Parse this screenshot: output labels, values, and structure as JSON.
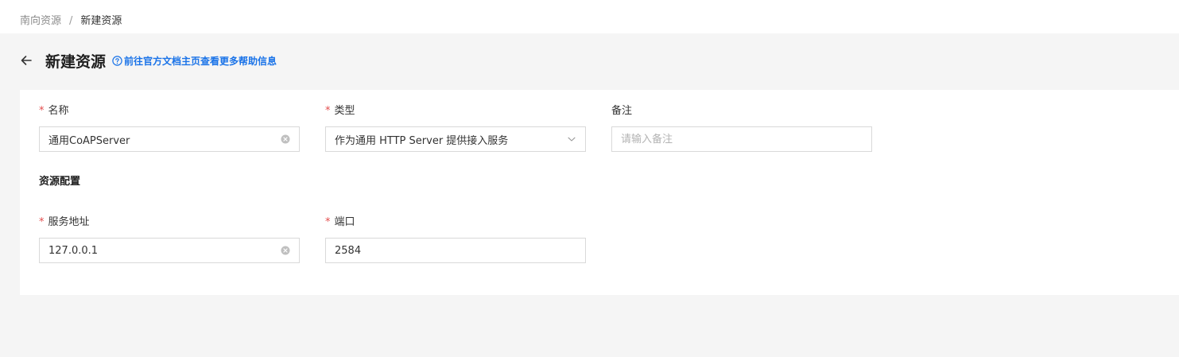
{
  "breadcrumb": {
    "parent": "南向资源",
    "separator": "/",
    "current": "新建资源"
  },
  "header": {
    "title": "新建资源",
    "help_link": "前往官方文档主页查看更多帮助信息"
  },
  "form": {
    "name": {
      "label": "名称",
      "required_mark": "*",
      "value": "通用CoAPServer"
    },
    "type": {
      "label": "类型",
      "required_mark": "*",
      "value": "作为通用 HTTP Server 提供接入服务"
    },
    "remark": {
      "label": "备注",
      "placeholder": "请输入备注"
    },
    "section_title": "资源配置",
    "address": {
      "label": "服务地址",
      "required_mark": "*",
      "value": "127.0.0.1"
    },
    "port": {
      "label": "端口",
      "required_mark": "*",
      "value": "2584"
    }
  },
  "colors": {
    "accent": "#1a73e8",
    "required": "#e34d4d",
    "background": "#f5f5f5"
  },
  "icons": {
    "back": "arrow-left-icon",
    "help": "question-circle-icon",
    "clear": "close-circle-icon",
    "dropdown": "chevron-down-icon"
  }
}
